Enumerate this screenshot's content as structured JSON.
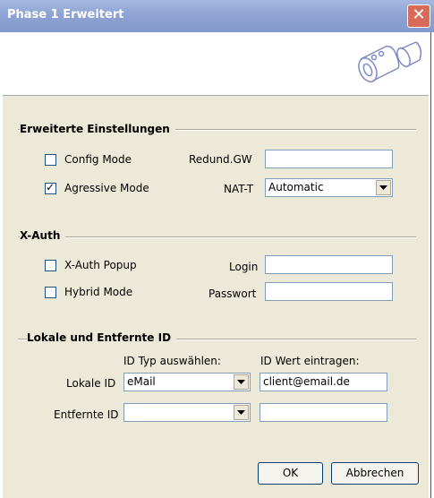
{
  "window": {
    "title": "Phase 1 Erweitert",
    "close_icon": "close-icon"
  },
  "sections": {
    "advanced": {
      "title": "Erweiterte Einstellungen",
      "config_mode": {
        "label": "Config Mode",
        "checked": false
      },
      "aggressive_mode": {
        "label": "Agressive Mode",
        "checked": true
      },
      "redund_gw": {
        "label": "Redund.GW",
        "value": ""
      },
      "nat_t": {
        "label": "NAT-T",
        "value": "Automatic"
      }
    },
    "xauth": {
      "title": "X-Auth",
      "popup": {
        "label": "X-Auth Popup",
        "checked": false
      },
      "hybrid": {
        "label": "Hybrid Mode",
        "checked": false
      },
      "login": {
        "label": "Login",
        "value": ""
      },
      "password": {
        "label": "Passwort",
        "value": ""
      }
    },
    "ids": {
      "title": "Lokale und Entfernte ID",
      "col_type": "ID Typ auswählen:",
      "col_value": "ID Wert eintragen:",
      "local": {
        "label": "Lokale ID",
        "type": "eMail",
        "value": "client@email.de"
      },
      "remote": {
        "label": "Entfernte ID",
        "type": "",
        "value": ""
      }
    }
  },
  "buttons": {
    "ok": "OK",
    "cancel": "Abbrechen"
  },
  "colors": {
    "titlebar": "#8ea3d3",
    "dialog_bg": "#ece9d8",
    "input_border": "#7f9db9"
  }
}
